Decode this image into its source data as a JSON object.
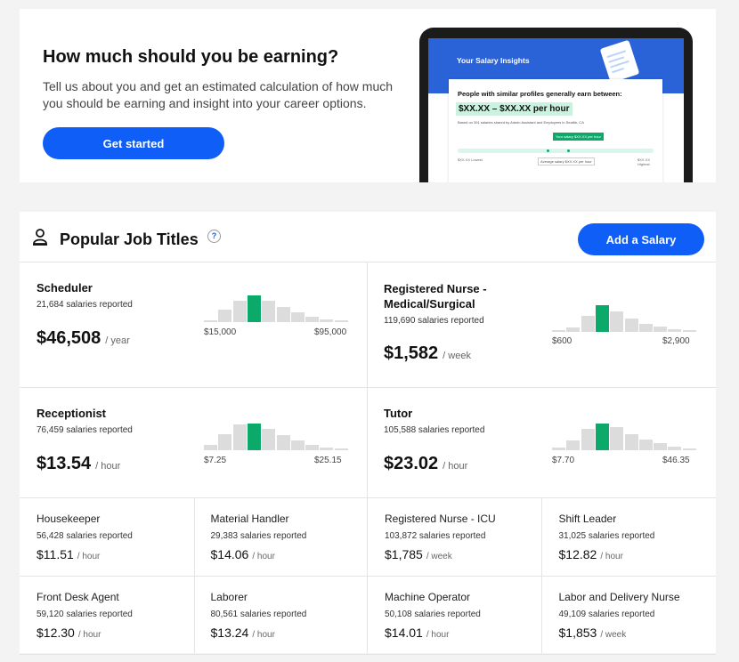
{
  "promo": {
    "title": "How much should you be earning?",
    "description": "Tell us about you and get an estimated calculation of how much you should be earning and insight into your career options.",
    "cta_label": "Get started",
    "mockup": {
      "header": "Your Salary Insights",
      "lead": "People with similar profiles generally earn between:",
      "range": "$XX.XX – $XX.XX per hour",
      "basis": "Based on 391 salaries shared by Admin Assistant and Employees in Seattle, CA",
      "tag": "Your salary $XX.XX per hour",
      "low_label": "$XX.XX Lowest",
      "avg_label": "Average salary $XX.XX per hour",
      "high_label": "$XX.XX Highest"
    }
  },
  "jobs": {
    "title": "Popular Job Titles",
    "help": "?",
    "add_salary_label": "Add a Salary",
    "featured": [
      {
        "name": "Scheduler",
        "count": "21,684 salaries reported",
        "pay": "$46,508",
        "unit": "/ year",
        "low": "$15,000",
        "high": "$95,000",
        "hist": [
          0.05,
          0.45,
          0.8,
          1.0,
          0.8,
          0.55,
          0.35,
          0.2,
          0.1,
          0.05
        ],
        "highlight": 3
      },
      {
        "name": "Registered Nurse - Medical/Surgical",
        "count": "119,690 salaries reported",
        "pay": "$1,582",
        "unit": "/ week",
        "low": "$600",
        "high": "$2,900",
        "hist": [
          0.05,
          0.15,
          0.6,
          1.0,
          0.75,
          0.5,
          0.3,
          0.2,
          0.1,
          0.05
        ],
        "highlight": 3
      },
      {
        "name": "Receptionist",
        "count": "76,459 salaries reported",
        "pay": "$13.54",
        "unit": "/ hour",
        "low": "$7.25",
        "high": "$25.15",
        "hist": [
          0.2,
          0.6,
          0.95,
          1.0,
          0.8,
          0.55,
          0.35,
          0.2,
          0.1,
          0.05
        ],
        "highlight": 3
      },
      {
        "name": "Tutor",
        "count": "105,588 salaries reported",
        "pay": "$23.02",
        "unit": "/ hour",
        "low": "$7.70",
        "high": "$46.35",
        "hist": [
          0.1,
          0.35,
          0.8,
          1.0,
          0.85,
          0.6,
          0.4,
          0.25,
          0.12,
          0.05
        ],
        "highlight": 3
      }
    ],
    "others": [
      {
        "name": "Housekeeper",
        "count": "56,428 salaries reported",
        "pay": "$11.51",
        "unit": "/ hour"
      },
      {
        "name": "Material Handler",
        "count": "29,383 salaries reported",
        "pay": "$14.06",
        "unit": "/ hour"
      },
      {
        "name": "Registered Nurse - ICU",
        "count": "103,872 salaries reported",
        "pay": "$1,785",
        "unit": "/ week"
      },
      {
        "name": "Shift Leader",
        "count": "31,025 salaries reported",
        "pay": "$12.82",
        "unit": "/ hour"
      },
      {
        "name": "Front Desk Agent",
        "count": "59,120 salaries reported",
        "pay": "$12.30",
        "unit": "/ hour"
      },
      {
        "name": "Laborer",
        "count": "80,561 salaries reported",
        "pay": "$13.24",
        "unit": "/ hour"
      },
      {
        "name": "Machine Operator",
        "count": "50,108 salaries reported",
        "pay": "$14.01",
        "unit": "/ hour"
      },
      {
        "name": "Labor and Delivery Nurse",
        "count": "49,109 salaries reported",
        "pay": "$1,853",
        "unit": "/ week"
      }
    ]
  },
  "colors": {
    "primary": "#0f5ef7",
    "highlight": "#0caa6a",
    "bar": "#dcdcdc"
  }
}
